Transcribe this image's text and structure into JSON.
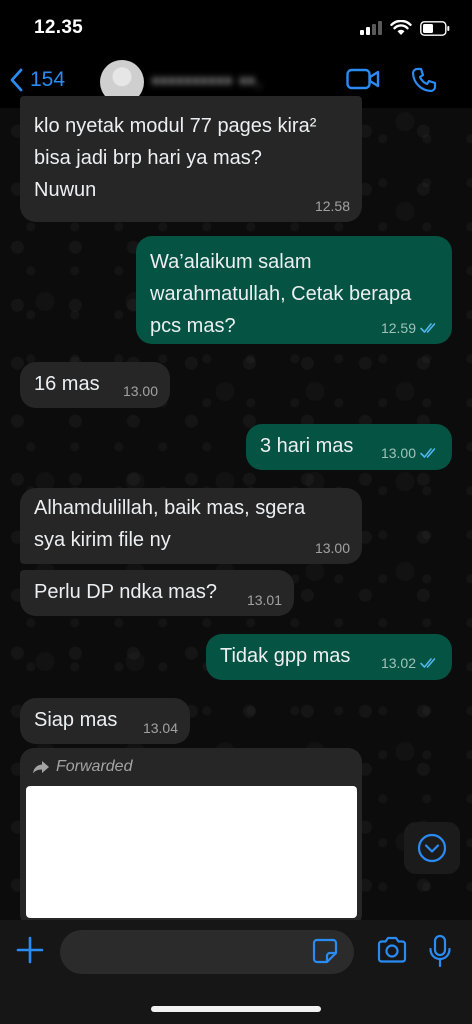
{
  "status_bar": {
    "time": "12.35"
  },
  "header": {
    "back_count": "154",
    "contact_name": "▪▪▪▪▪▪▪▪▪▪ ▪▪."
  },
  "messages": [
    {
      "dir": "in",
      "text": "klo nyetak modul 77 pages kira²\nbisa jadi brp hari ya mas?\nNuwun",
      "time": "12.58"
    },
    {
      "dir": "out",
      "text": "Wa’alaikum salam\nwarahmatullah, Cetak berapa\npcs mas?",
      "time": "12.59"
    },
    {
      "dir": "in",
      "text": "16 mas",
      "time": "13.00"
    },
    {
      "dir": "out",
      "text": "3 hari mas",
      "time": "13.00"
    },
    {
      "dir": "in",
      "text": "Alhamdulillah, baik mas, sgera\nsya kirim file ny",
      "time": "13.00"
    },
    {
      "dir": "in",
      "text": "Perlu DP ndka mas?",
      "time": "13.01"
    },
    {
      "dir": "out",
      "text": "Tidak gpp mas",
      "time": "13.02"
    },
    {
      "dir": "in",
      "text": "Siap mas",
      "time": "13.04"
    }
  ],
  "forwarded": {
    "label": "Forwarded"
  },
  "composer": {
    "placeholder": ""
  },
  "colors": {
    "accent": "#2a8bf2",
    "outgoing": "#045343",
    "incoming": "#262626",
    "read_ticks": "#4fb6ec"
  },
  "icons": [
    "back-chevron-icon",
    "video-call-icon",
    "phone-icon",
    "plus-icon",
    "sticker-icon",
    "camera-icon",
    "mic-icon",
    "chevron-down-icon",
    "forward-arrow-icon",
    "double-check-icon"
  ]
}
